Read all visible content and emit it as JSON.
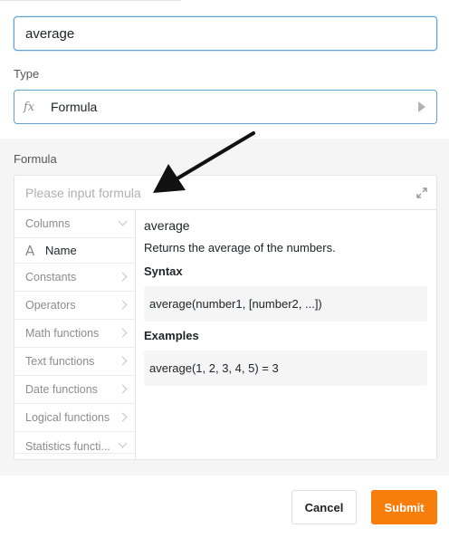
{
  "name_field": {
    "value": "average"
  },
  "type": {
    "label": "Type",
    "icon": "fx-icon",
    "value": "Formula"
  },
  "formula": {
    "label": "Formula",
    "placeholder": "Please input formula",
    "nav": [
      {
        "label": "Columns",
        "expanded": true
      },
      {
        "label": "Constants"
      },
      {
        "label": "Operators"
      },
      {
        "label": "Math functions"
      },
      {
        "label": "Text functions"
      },
      {
        "label": "Date functions"
      },
      {
        "label": "Logical functions"
      },
      {
        "label": "Statistics functi..."
      }
    ],
    "columns": [
      {
        "label": "Name",
        "icon": "text-column-icon"
      }
    ],
    "detail": {
      "name": "average",
      "description": "Returns the average of the numbers.",
      "syntax_title": "Syntax",
      "syntax": "average(number1, [number2, ...])",
      "examples_title": "Examples",
      "example": "average(1, 2, 3, 4, 5) = 3"
    }
  },
  "footer": {
    "cancel_label": "Cancel",
    "submit_label": "Submit"
  },
  "colors": {
    "accent": "#f77e0b",
    "focus_border": "#5fa3d3"
  }
}
